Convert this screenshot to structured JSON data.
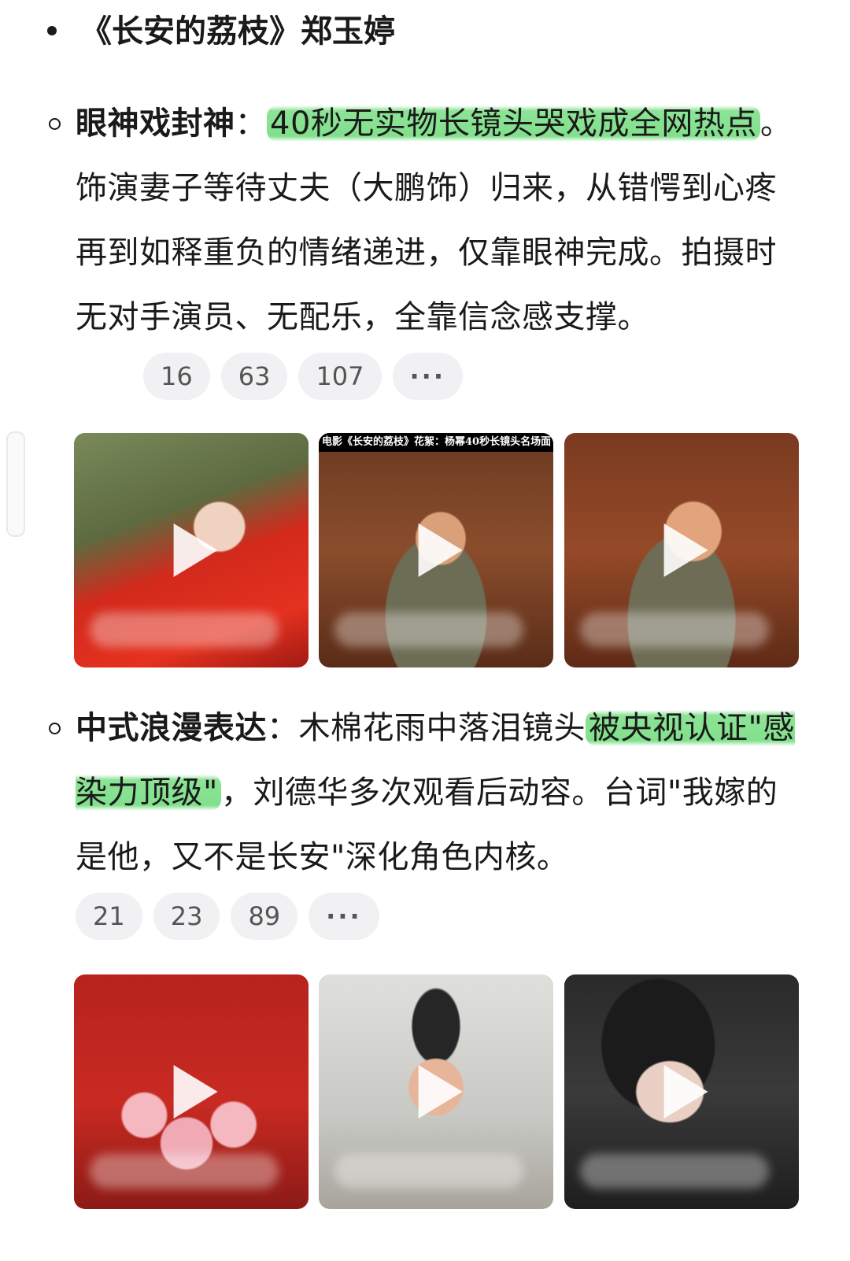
{
  "header": {
    "title": "《长安的荔枝》郑玉婷"
  },
  "section1": {
    "label": "眼神戏封神",
    "colon": "：",
    "highlight": "40秒无实物长镜头哭戏成全网热点",
    "text": "。饰演妻子等待丈夫（大鹏饰）归来，从错愕到心疼再到如释重负的情绪递进，仅靠眼神完成。拍摄时无对手演员、无配乐，全靠信念感支撑。",
    "pills": [
      "16",
      "63",
      "107"
    ],
    "more": "···",
    "thumbs": [
      {
        "icon": "play-icon"
      },
      {
        "icon": "play-icon",
        "banner": "电影《长安的荔枝》花絮：杨幂40秒长镜头名场面"
      },
      {
        "icon": "play-icon"
      }
    ]
  },
  "section2": {
    "label": "中式浪漫表达",
    "colon": "：",
    "text_before": "木棉花雨中落泪镜头",
    "highlight": "被央视认证\"感染力顶级\"",
    "text_after": "，刘德华多次观看后动容。台词\"我嫁的是他，又不是长安\"深化角色内核。",
    "pills": [
      "21",
      "23",
      "89"
    ],
    "more": "···",
    "thumbs": [
      {
        "icon": "play-icon"
      },
      {
        "icon": "play-icon"
      },
      {
        "icon": "play-icon"
      }
    ]
  },
  "colors": {
    "highlight": "#2ecc40",
    "pill_bg": "#f1f1f3",
    "text": "#1a1a1a"
  }
}
